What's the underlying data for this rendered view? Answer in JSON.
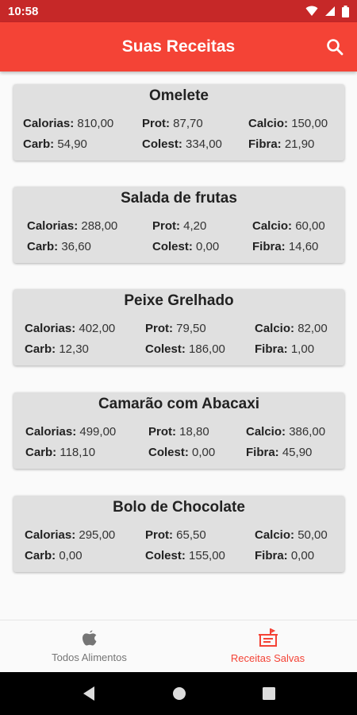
{
  "status": {
    "time": "10:58"
  },
  "app_bar": {
    "title": "Suas Receitas"
  },
  "labels": {
    "calorias": "Calorias:",
    "prot": "Prot:",
    "calcio": "Calcio:",
    "carb": "Carb:",
    "colest": "Colest:",
    "fibra": "Fibra:"
  },
  "recipes": [
    {
      "name": "Omelete",
      "calorias": "810,00",
      "prot": "87,70",
      "calcio": "150,00",
      "carb": "54,90",
      "colest": "334,00",
      "fibra": "21,90"
    },
    {
      "name": "Salada de frutas",
      "calorias": "288,00",
      "prot": "4,20",
      "calcio": "60,00",
      "carb": "36,60",
      "colest": "0,00",
      "fibra": "14,60"
    },
    {
      "name": "Peixe Grelhado",
      "calorias": "402,00",
      "prot": "79,50",
      "calcio": "82,00",
      "carb": "12,30",
      "colest": "186,00",
      "fibra": "1,00"
    },
    {
      "name": "Camarão com Abacaxi",
      "calorias": "499,00",
      "prot": "18,80",
      "calcio": "386,00",
      "carb": "118,10",
      "colest": "0,00",
      "fibra": "45,90"
    },
    {
      "name": "Bolo de Chocolate",
      "calorias": "295,00",
      "prot": "65,50",
      "calcio": "50,00",
      "carb": "0,00",
      "colest": "155,00",
      "fibra": "0,00"
    }
  ],
  "bottom_nav": {
    "items": [
      {
        "label": "Todos Alimentos",
        "icon": "apple-icon",
        "active": false
      },
      {
        "label": "Receitas Salvas",
        "icon": "recipe-book-icon",
        "active": true
      }
    ]
  },
  "colors": {
    "primary": "#f44336",
    "status_bar": "#c62828",
    "card_bg": "#e0e0e0",
    "active": "#f44336",
    "inactive": "#757575"
  }
}
